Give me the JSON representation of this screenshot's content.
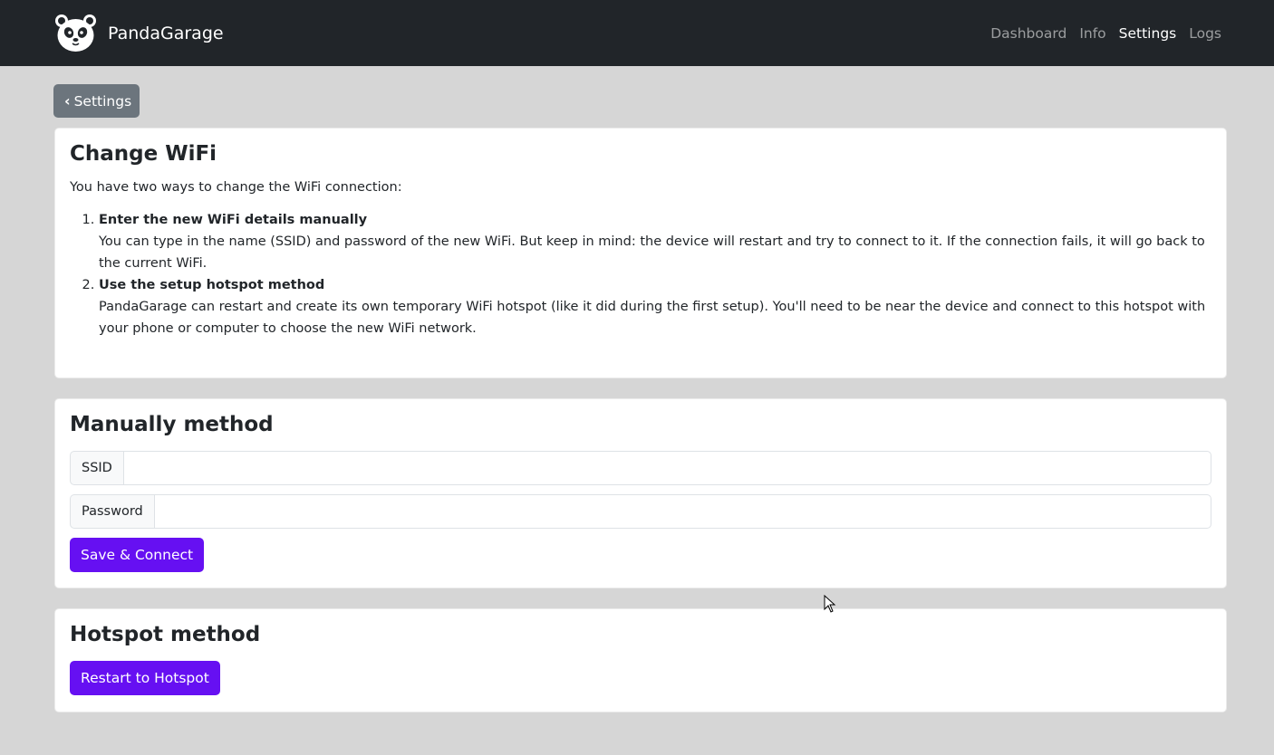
{
  "navbar": {
    "brand": "PandaGarage",
    "links": [
      {
        "label": "Dashboard"
      },
      {
        "label": "Info"
      },
      {
        "label": "Settings",
        "active": true
      },
      {
        "label": "Logs"
      }
    ]
  },
  "back_button": {
    "label": "Settings",
    "icon": "chevron-left-icon"
  },
  "change_wifi": {
    "title": "Change WiFi",
    "intro": "You have two ways to change the WiFi connection:",
    "items": [
      {
        "title": "Enter the new WiFi details manually",
        "text": "You can type in the name (SSID) and password of the new WiFi. But keep in mind: the device will restart and try to connect to it. If the connection fails, it will go back to the current WiFi."
      },
      {
        "title": "Use the setup hotspot method",
        "text": "PandaGarage can restart and create its own temporary WiFi hotspot (like it did during the first setup). You'll need to be near the device and connect to this hotspot with your phone or computer to choose the new WiFi network."
      }
    ]
  },
  "manual": {
    "title": "Manually method",
    "ssid_label": "SSID",
    "ssid_value": "",
    "password_label": "Password",
    "password_value": "",
    "save_label": "Save & Connect"
  },
  "hotspot": {
    "title": "Hotspot method",
    "restart_label": "Restart to Hotspot"
  },
  "colors": {
    "navbar": "#212529",
    "background": "#d6d6d6",
    "primary": "#6610f2",
    "secondary": "#6c757d"
  }
}
